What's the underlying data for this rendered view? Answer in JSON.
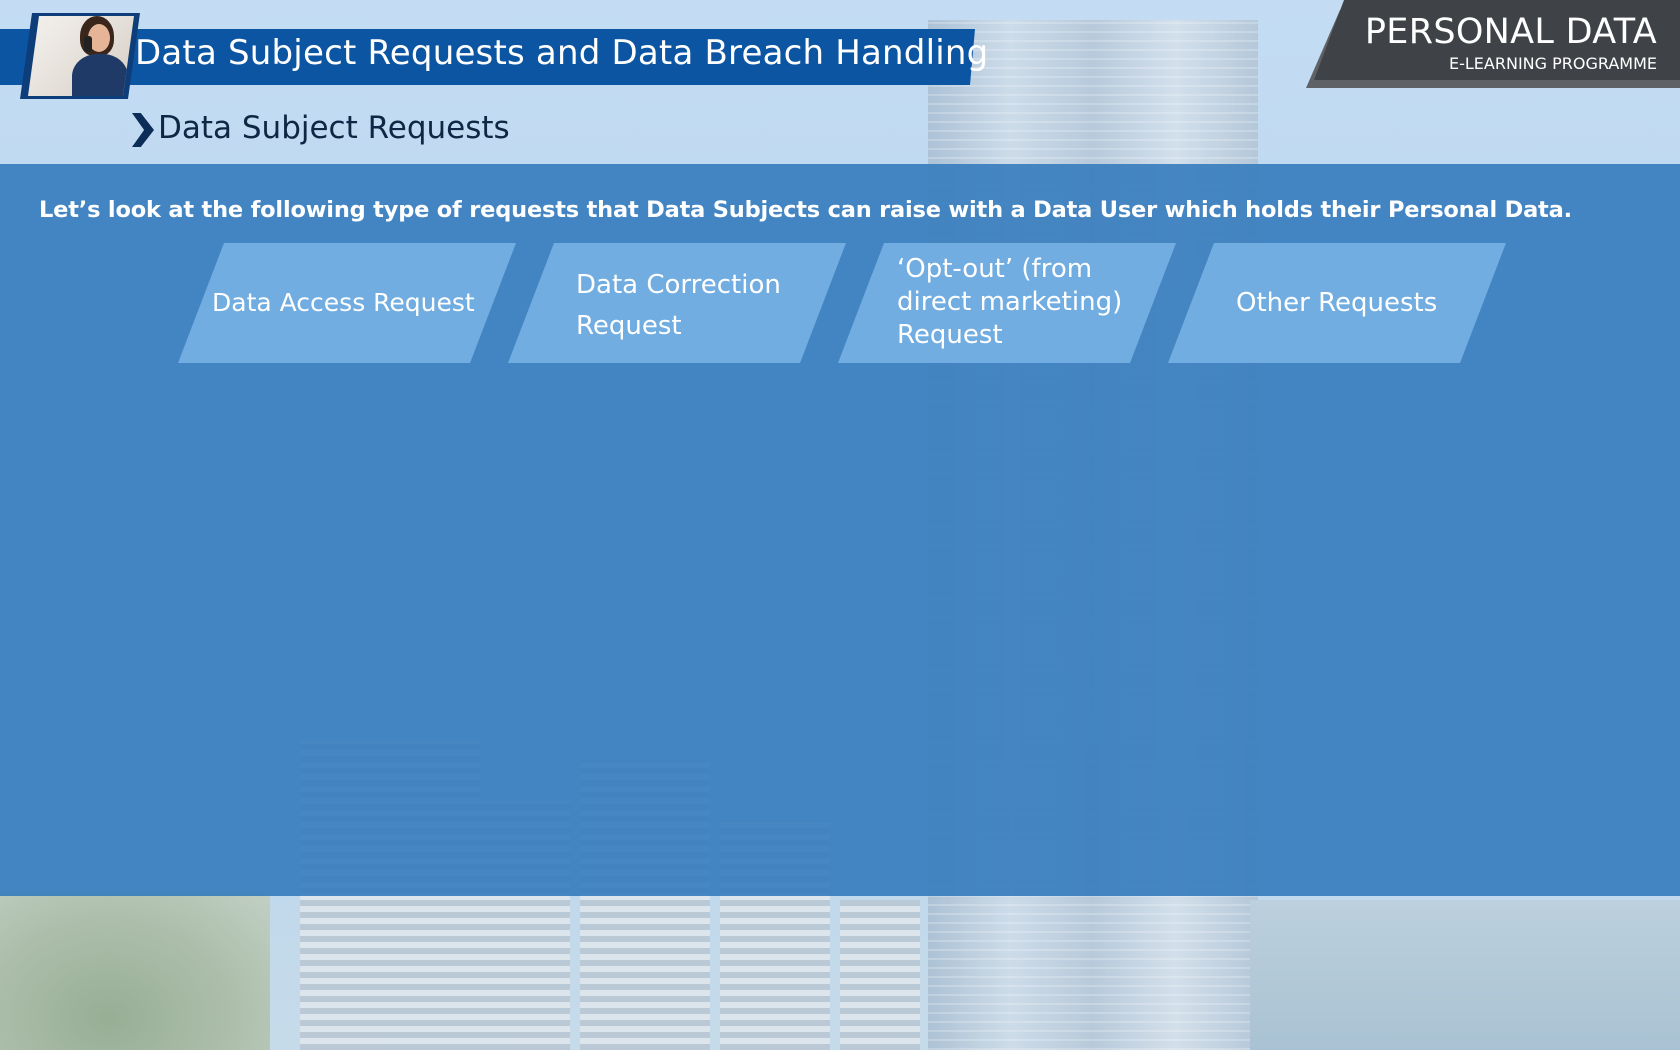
{
  "header": {
    "module_title": "Data Subject Requests and Data Breach Handling",
    "section_title": "Data Subject Requests"
  },
  "brand": {
    "title": "PERSONAL DATA",
    "subtitle": "E-LEARNING PROGRAMME"
  },
  "content": {
    "intro": "Let’s look at the following type of requests that Data Subjects can raise with a Data User which holds their Personal Data.",
    "cards": [
      {
        "label": "Data Access Request"
      },
      {
        "label": "Data Correction Request"
      },
      {
        "label": "‘Opt-out’ (from direct marketing) Request"
      },
      {
        "label": "Other Requests"
      }
    ]
  },
  "colors": {
    "panel": "#387ebe",
    "card": "#71ade0",
    "title_banner": "#0c55a3",
    "brand_badge": "#3f4347"
  }
}
